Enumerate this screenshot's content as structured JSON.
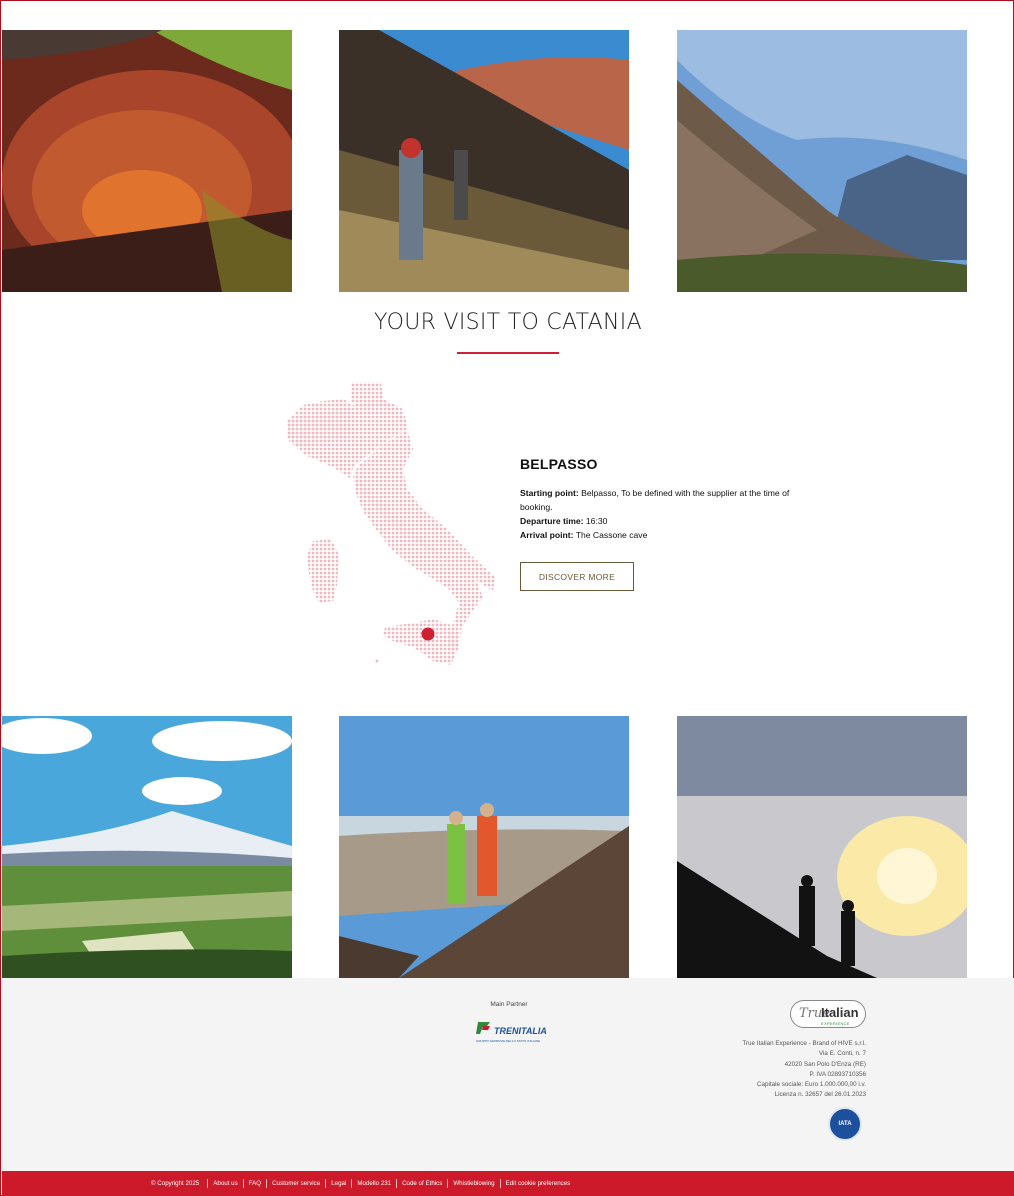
{
  "section": {
    "title": "YOUR VISIT TO CATANIA"
  },
  "tour": {
    "name": "BELPASSO",
    "starting_label": "Starting point:",
    "starting_value": " Belpasso, To be defined with the supplier at the time of booking.",
    "departure_label": "Departure time:",
    "departure_value": " 16:30",
    "arrival_label": "Arrival point:",
    "arrival_value": " The Cassone cave",
    "button": "DISCOVER MORE"
  },
  "footer": {
    "partner_label": "Main Partner",
    "partner_name": "TRENITALIA",
    "partner_tagline": "GRUPPO FERROVIE DELLO STATO ITALIANE",
    "brand_word1": "True",
    "brand_word2": "Italian",
    "brand_word3": "EXPERIENCE",
    "company_lines": [
      "True Italian Experience - Brand of HIVE s.r.l.",
      "Via E. Conti, n. 7",
      "42020 San Polo D'Enza (RE)",
      "P. IVA 02893710356",
      "Capitale sociale: Euro 1.000.000,00 i.v.",
      "Licenza n. 32657 del 26.01.2023"
    ],
    "iata": "IATA"
  },
  "bottom_links": [
    "© Copyright 2025",
    "About us",
    "FAQ",
    "Customer service",
    "Legal",
    "Modello 231",
    "Code of Ethics",
    "Whistleblowing",
    "Edit cookie preferences"
  ],
  "colors": {
    "accent": "#cc1a2b",
    "button_border": "#6a5a3a",
    "map_dots": "#f0b8bf",
    "footer_bg": "#f4f4f4"
  }
}
